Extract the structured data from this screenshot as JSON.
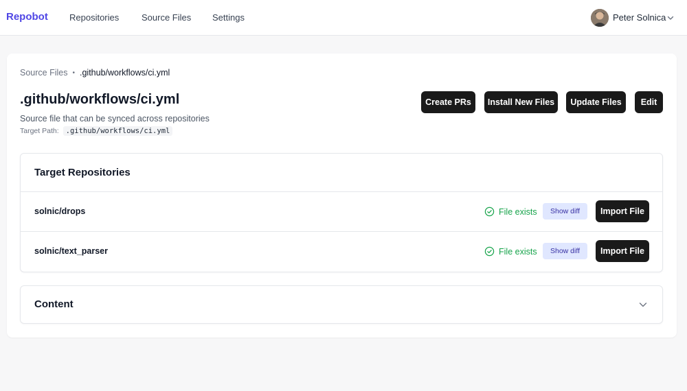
{
  "nav": {
    "brand": "Repobot",
    "links": [
      "Repositories",
      "Source Files",
      "Settings"
    ],
    "user": {
      "name": "Peter Solnica",
      "avatar_icon": "user-avatar"
    }
  },
  "breadcrumb": {
    "parent": "Source Files",
    "separator": "•",
    "current": ".github/workflows/ci.yml"
  },
  "header": {
    "title": ".github/workflows/ci.yml",
    "subtitle": "Source file that can be synced across repositories",
    "target_path_label": "Target Path:",
    "target_path": ".github/workflows/ci.yml"
  },
  "actions": {
    "create_prs": "Create PRs",
    "install_new_files": "Install New Files",
    "update_files": "Update Files",
    "edit": "Edit"
  },
  "repositories": {
    "title": "Target Repositories",
    "rows": [
      {
        "name": "solnic/drops",
        "status": "File exists",
        "diff_label": "Show diff",
        "import_label": "Import File"
      },
      {
        "name": "solnic/text_parser",
        "status": "File exists",
        "diff_label": "Show diff",
        "import_label": "Import File"
      }
    ]
  },
  "content": {
    "title": "Content"
  },
  "colors": {
    "brand": "#4f46e5",
    "success": "#16a34a",
    "dark_button": "#1a1a1a",
    "diff_button_bg": "#e0e7ff"
  }
}
